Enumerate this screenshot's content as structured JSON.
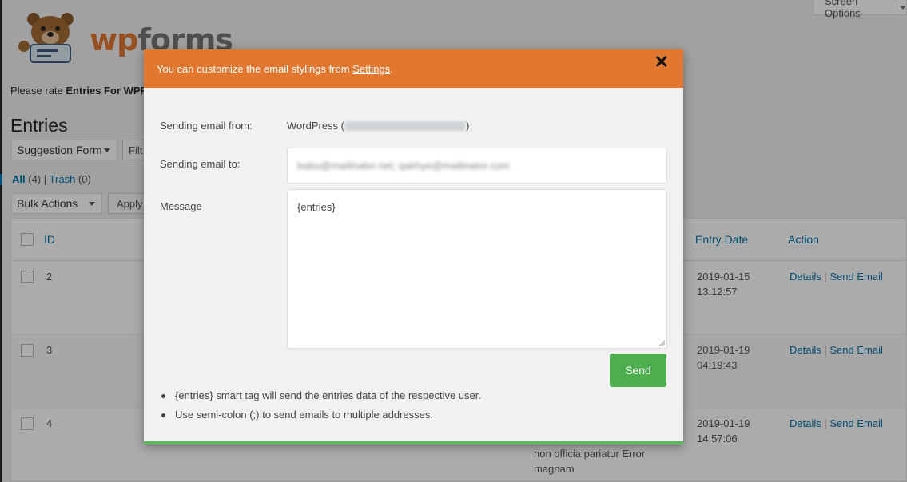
{
  "screen_options": "Screen Options",
  "logo": {
    "wp": "wp",
    "forms": "forms"
  },
  "rate_notice": {
    "prefix": "Please rate ",
    "bold": "Entries For WPFo"
  },
  "page_title": "Entries",
  "form_select": {
    "selected": "Suggestion Form",
    "filter_btn": "Filt"
  },
  "views": {
    "all_label": "All",
    "all_count": "(4)",
    "sep": "|",
    "trash_label": "Trash",
    "trash_count": "(0)"
  },
  "bulk": {
    "selected": "Bulk Actions",
    "apply_btn": "Apply"
  },
  "table": {
    "headers": {
      "id": "ID",
      "entry_date": "Entry Date",
      "action": "Action"
    },
    "rows": [
      {
        "id": "2",
        "date": "2019-01-15",
        "time": "13:12:57",
        "details": "Details",
        "send": "Send Email"
      },
      {
        "id": "3",
        "date": "2019-01-19",
        "time": "04:19:43",
        "details": "Details",
        "send": "Send Email"
      },
      {
        "id": "4",
        "date": "2019-01-19",
        "time": "14:57:06",
        "details": "Details",
        "send": "Send Email",
        "message_line1": "non officia pariatur Error",
        "message_line2": "magnam"
      }
    ]
  },
  "modal": {
    "header_prefix": "You can customize the email stylings from ",
    "header_link": "Settings",
    "header_suffix": ".",
    "close": "✕",
    "from_label": "Sending email from:",
    "from_value_prefix": "WordPress (",
    "from_value_suffix": ")",
    "to_label": "Sending email to:",
    "to_value": "babu@mailinator.net; qakhye@mailinator.com",
    "message_label": "Message",
    "message_value": "{entries}",
    "send_btn": "Send",
    "notes": [
      "{entries} smart tag will send the entries data of the respective user.",
      "Use semi-colon (;) to send emails to multiple addresses."
    ]
  },
  "colors": {
    "header_orange": "#e27730",
    "send_green": "#4cae4c",
    "link_blue": "#0073aa"
  }
}
